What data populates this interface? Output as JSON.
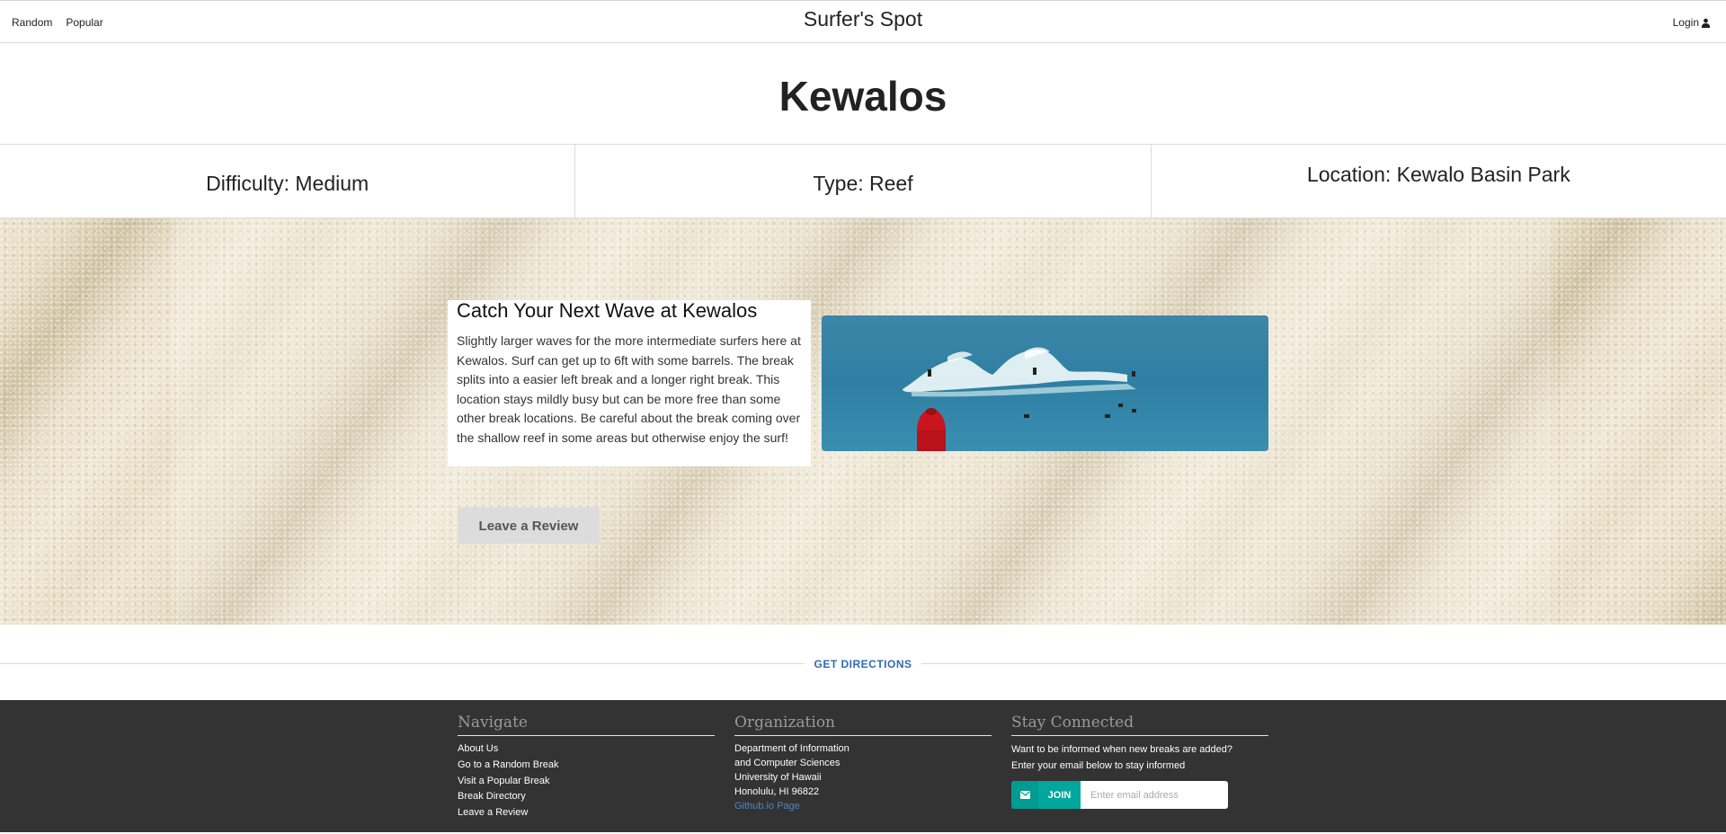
{
  "topbar": {
    "nav_random": "Random",
    "nav_popular": "Popular",
    "brand": "Surfer's Spot",
    "login": "Login",
    "login_icon": "user-icon"
  },
  "break": {
    "name": "Kewalos",
    "difficulty": "Difficulty: Medium",
    "type": "Type: Reef",
    "location": "Location: Kewalo Basin Park",
    "heading": "Catch Your Next Wave at Kewalos",
    "description": "Slightly larger waves for the more intermediate surfers here at Kewalos. Surf can get up to 6ft with some barrels. The break splits into a easier left break and a longer right break. This location stays mildly busy but can be more free than some other break locations. Be careful about the break coming over the shallow reef in some areas but otherwise enjoy the surf!",
    "review_button": "Leave a Review"
  },
  "directions": {
    "label": "GET DIRECTIONS"
  },
  "footer": {
    "navigate": {
      "title": "Navigate",
      "items": [
        "About Us",
        "Go to a Random Break",
        "Visit a Popular Break",
        "Break Directory",
        "Leave a Review"
      ]
    },
    "organization": {
      "title": "Organization",
      "lines": [
        "Department of Information",
        "and Computer Sciences",
        "University of Hawaii",
        "Honolulu, HI 96822"
      ],
      "link": "Github.io Page"
    },
    "stay": {
      "title": "Stay Connected",
      "line1": "Want to be informed when new breaks are added?",
      "line2": "Enter your email below to stay informed",
      "join_label": "JOIN",
      "join_icon": "envelope-icon",
      "email_placeholder": "Enter email address"
    }
  },
  "colors": {
    "accent_teal": "#00a79d",
    "link_blue": "#2e6bb5",
    "footer_bg": "#333333"
  }
}
